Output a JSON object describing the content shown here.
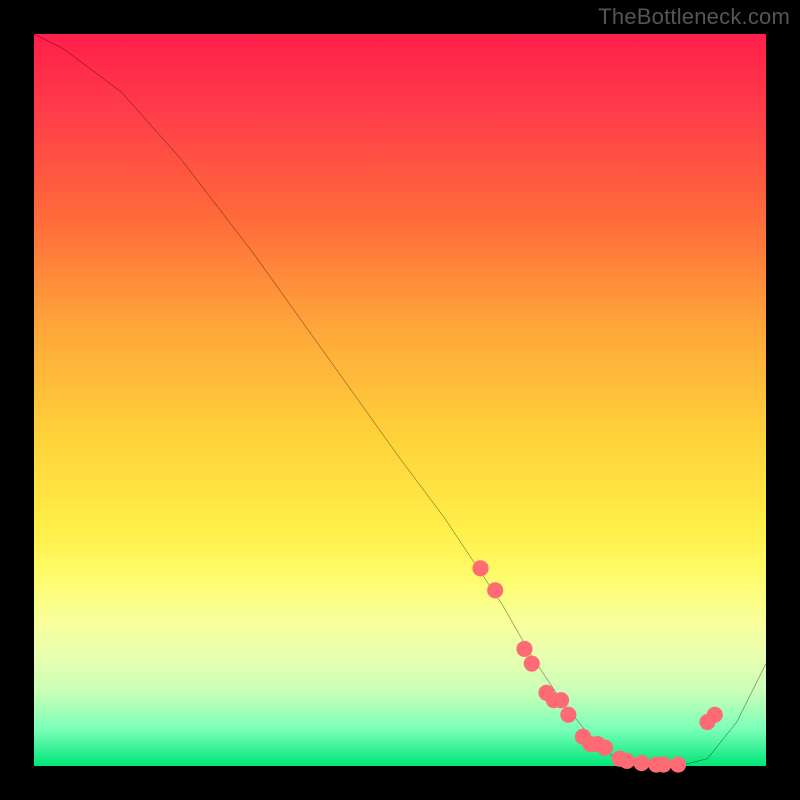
{
  "attribution": "TheBottleneck.com",
  "chart_data": {
    "type": "line",
    "title": "",
    "xlabel": "",
    "ylabel": "",
    "xlim": [
      0,
      100
    ],
    "ylim": [
      0,
      100
    ],
    "series": [
      {
        "name": "main-curve",
        "x": [
          0,
          4,
          8,
          12,
          20,
          30,
          40,
          50,
          56,
          60,
          64,
          68,
          72,
          76,
          80,
          84,
          88,
          92,
          96,
          100
        ],
        "values": [
          100,
          98,
          95,
          92,
          83,
          70,
          56,
          42,
          34,
          28,
          22,
          15,
          9,
          4,
          0.5,
          0,
          0,
          1,
          6,
          14
        ]
      }
    ],
    "markers": {
      "name": "highlight-dots",
      "color": "#ff6b75",
      "x": [
        61,
        63,
        67,
        68,
        70,
        71,
        72,
        73,
        75,
        76,
        77,
        78,
        80,
        81,
        83,
        85,
        86,
        88,
        92,
        93
      ],
      "values": [
        27,
        24,
        16,
        14,
        10,
        9,
        9,
        7,
        4,
        3,
        3,
        2.5,
        1,
        0.7,
        0.4,
        0.2,
        0.2,
        0.2,
        6,
        7
      ]
    },
    "colors": {
      "line": "#000000",
      "marker": "#ff6b75",
      "background_top": "#ff1e4a",
      "background_bottom": "#00e676",
      "page": "#000000"
    }
  }
}
